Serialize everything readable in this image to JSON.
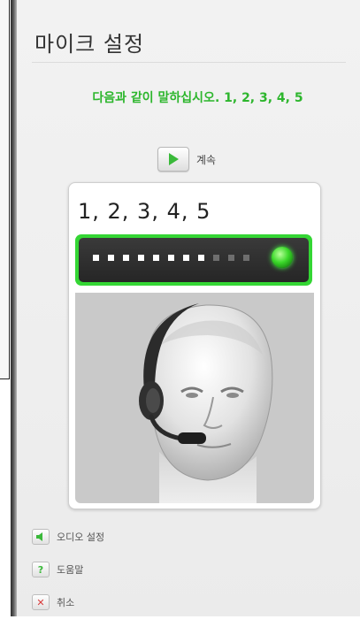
{
  "window": {
    "title": "마이크 설정"
  },
  "instruction": {
    "text": "다음과 같이 말하십시오. 1, 2, 3, 4, 5"
  },
  "continue_button": {
    "label": "계속",
    "icon": "play-icon"
  },
  "prompt_card": {
    "numbers": "1, 2, 3, 4, 5",
    "level_meter": {
      "active_bars": 8,
      "total_bars": 11,
      "indicator": "green-led"
    },
    "image": "headset-head-illustration"
  },
  "menu": [
    {
      "label": "오디오 설정",
      "icon": "speaker-icon"
    },
    {
      "label": "도움말",
      "icon": "question-icon"
    },
    {
      "label": "취소",
      "icon": "close-icon"
    }
  ],
  "colors": {
    "accent_green": "#34d634",
    "instruction_green": "#2db62d",
    "cancel_red": "#d83a3a",
    "meter_background": "#2a2a2a"
  }
}
